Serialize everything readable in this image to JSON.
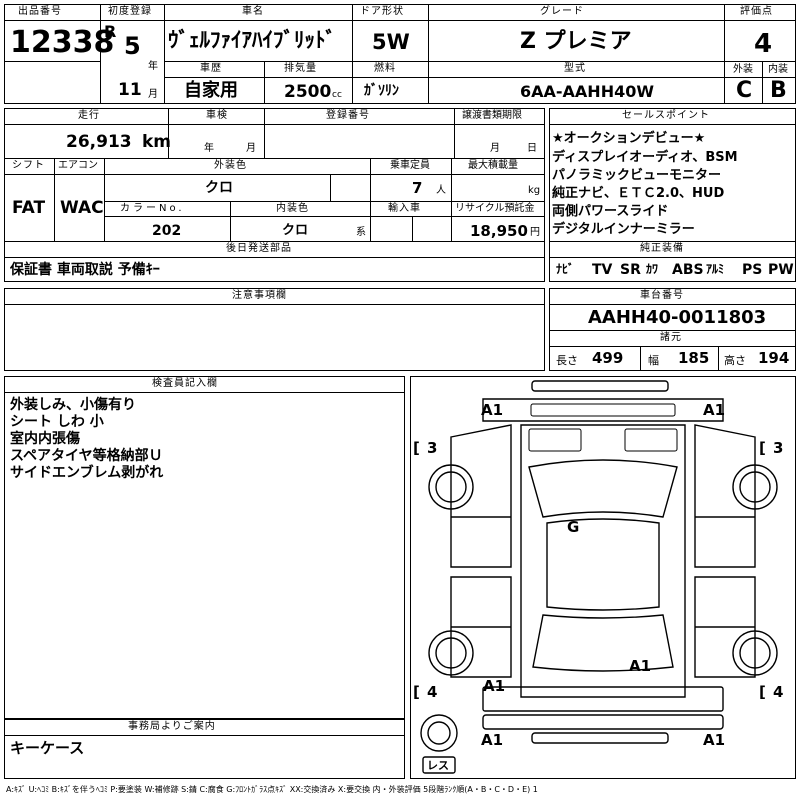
{
  "header": {
    "lot_no_label": "出品番号",
    "lot_no": "12338",
    "first_reg_label": "初度登録",
    "era": "R",
    "year": "5",
    "year_unit": "年",
    "month": "11",
    "month_unit": "月",
    "car_name_label": "車名",
    "car_name": "ｳﾞｪﾙﾌｧｲｱﾊｲﾌﾞﾘｯﾄﾞ",
    "door_label": "ドア形状",
    "door": "5W",
    "grade_label": "グレード",
    "grade": "Z プレミア",
    "score_label": "評価点",
    "score": "4",
    "history_label": "車歴",
    "history": "自家用",
    "displacement_label": "排気量",
    "displacement": "2500",
    "displacement_unit": "cc",
    "fuel_label": "燃料",
    "fuel": "ｶﾞｿﾘﾝ",
    "model_label": "型式",
    "model": "6AA-AAHH40W",
    "exterior_label": "外装",
    "exterior": "C",
    "interior_label": "内装",
    "interior": "B"
  },
  "details": {
    "mileage_label": "走行",
    "mileage": "26,913",
    "mileage_unit": "km",
    "inspection_label": "車検",
    "inspection_year_unit": "年",
    "inspection_month_unit": "月",
    "reg_no_label": "登録番号",
    "transfer_label": "譲渡書類期限",
    "transfer_month_unit": "月",
    "transfer_day_unit": "日",
    "shift_label": "シフト",
    "shift": "FAT",
    "ac_label": "エアコン",
    "ac": "WAC",
    "ext_color_label": "外装色",
    "ext_color": "クロ",
    "capacity_label": "乗車定員",
    "capacity": "7",
    "capacity_unit": "人",
    "max_load_label": "最大積載量",
    "max_load_unit": "kg",
    "color_no_label": "カラーNo.",
    "color_no": "202",
    "int_color_label": "内装色",
    "int_color": "クロ",
    "int_color_unit": "系",
    "import_label": "輸入車",
    "recycle_label": "リサイクル預託金",
    "recycle": "18,950",
    "recycle_unit": "円"
  },
  "sales_points": {
    "label": "セールスポイント",
    "lines": [
      "★オークションデビュー★",
      "ディスプレイオーディオ、BSM",
      "パノラミックビューモニター",
      "純正ナビ、ＥＴＣ2.0、HUD",
      "両側パワースライド",
      "デジタルインナーミラー"
    ]
  },
  "later_parts": {
    "label": "後日発送部品",
    "value": "保証書 車両取説 予備ｷｰ"
  },
  "equipment": {
    "label": "純正装備",
    "items": [
      "ﾅﾋﾞ",
      "TV",
      "SR",
      "ｶﾜ",
      "ABS",
      "ｱﾙﾐ",
      "PS",
      "PW"
    ]
  },
  "notes": {
    "label": "注意事項欄"
  },
  "chassis": {
    "label": "車台番号",
    "value": "AAHH40-0011803"
  },
  "specs": {
    "label": "諸元",
    "length_label": "長さ",
    "length": "499",
    "width_label": "幅",
    "width": "185",
    "height_label": "高さ",
    "height": "194"
  },
  "inspector": {
    "label": "検査員記入欄",
    "lines": [
      "外装しみ、小傷有り",
      "シート しわ 小",
      "室内内張傷",
      "スペアタイヤ等格納部Ｕ",
      "サイドエンブレム剥がれ"
    ]
  },
  "office": {
    "label": "事務局よりご案内",
    "value": "キーケース"
  },
  "diagram": {
    "marks": {
      "front_left": "A1",
      "front_right": "A1",
      "windshield": "G",
      "rear_center": "A1",
      "rear_left": "A1",
      "rear_bottom_left": "A1",
      "rear_bottom_right": "A1"
    },
    "tires": {
      "front_left": "3",
      "front_right": "3",
      "rear_left": "4",
      "rear_right": "4",
      "spare": "レス"
    }
  },
  "legend": "A:ｷｽﾞ U:ﾍｺﾐ B:ｷｽﾞを伴うﾍｺﾐ P:要塗装 W:補修跡 S:錆 C:腐食 G:ﾌﾛﾝﾄｶﾞﾗｽ点ｷｽﾞ XX:交換済み X:要交換 内・外装評価 5段階ﾗﾝｸ順(A・B・C・D・E) 1"
}
